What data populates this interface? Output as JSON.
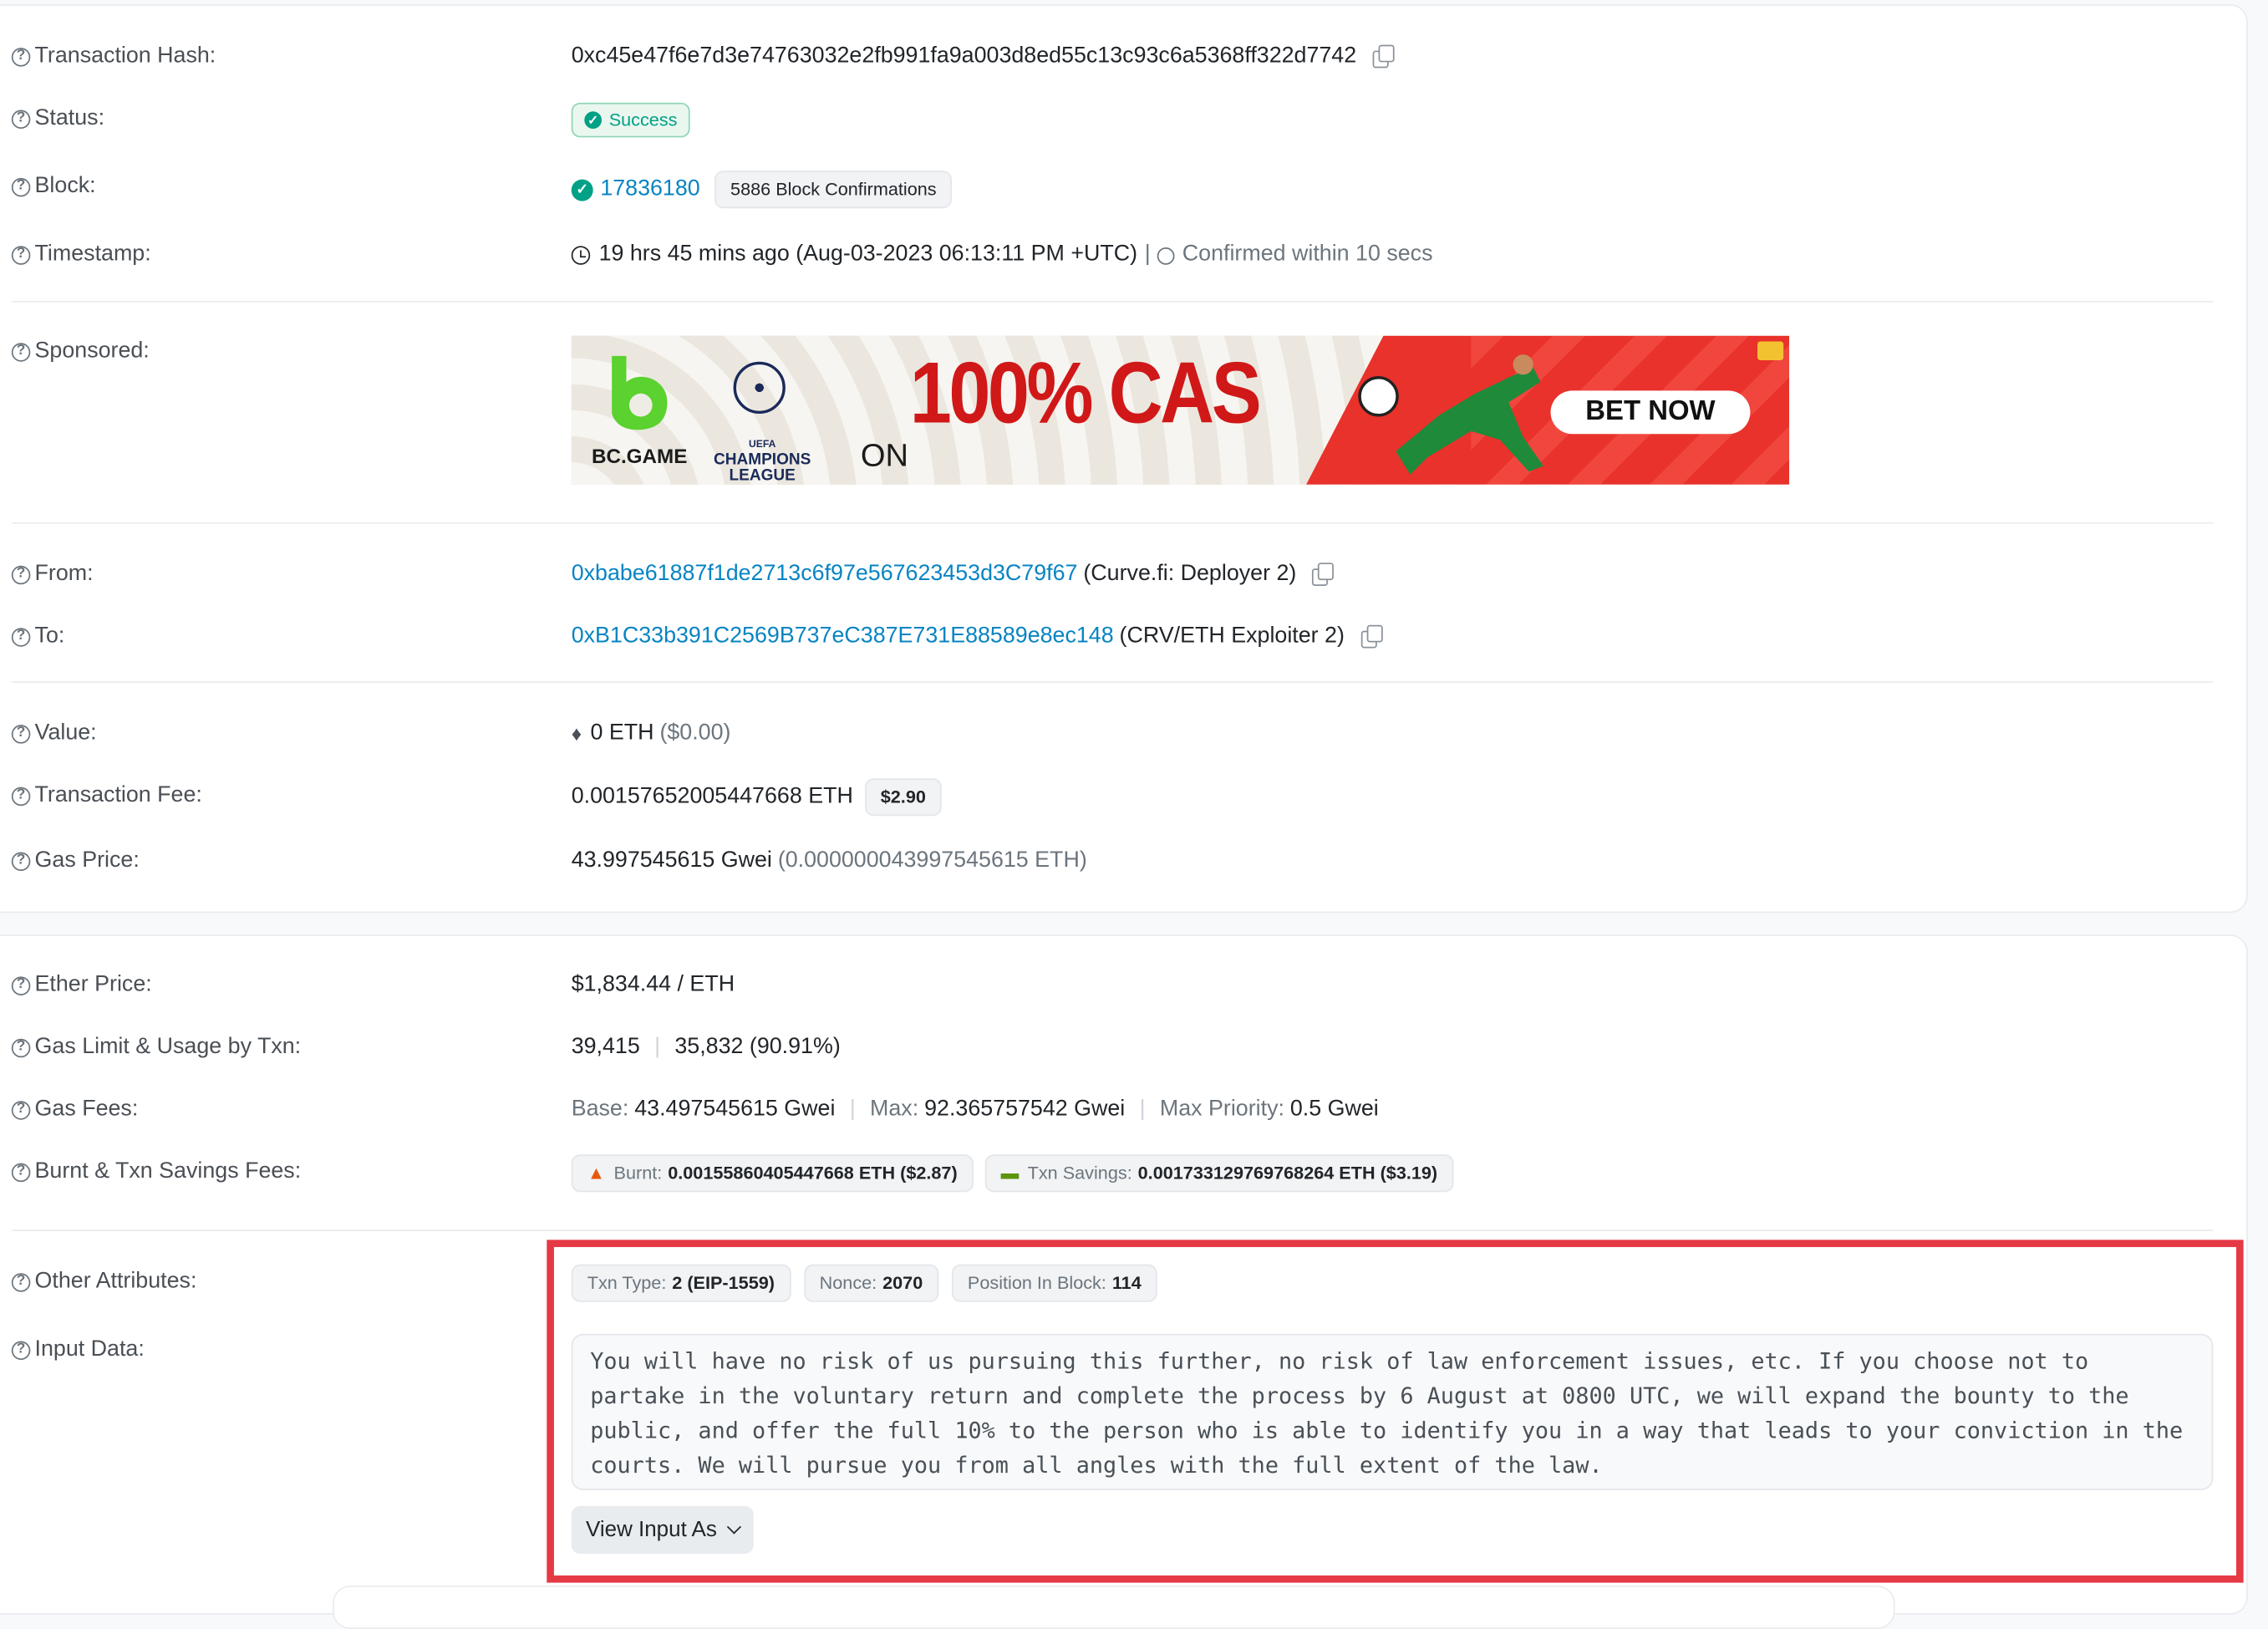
{
  "overview": {
    "tx_hash_label": "Transaction Hash:",
    "tx_hash": "0xc45e47f6e7d3e74763032e2fb991fa9a003d8ed55c13c93c6a5368ff322d7742",
    "status_label": "Status:",
    "status": "Success",
    "block_label": "Block:",
    "block": "17836180",
    "block_confirmations": "5886 Block Confirmations",
    "timestamp_label": "Timestamp:",
    "timestamp": "19 hrs 45 mins ago (Aug-03-2023 06:13:11 PM +UTC)",
    "timestamp_sep": "|",
    "confirmed_within": "Confirmed within 10 secs",
    "sponsored_label": "Sponsored:",
    "ad": {
      "brand": "BC.GAME",
      "uefa_top": "UEFA",
      "uefa_line1": "CHAMPIONS",
      "uefa_line2": "LEAGUE",
      "headline": "100% CAS",
      "on": "ON",
      "cta": "BET NOW"
    },
    "from_label": "From:",
    "from_address": "0xbabe61887f1de2713c6f97e567623453d3C79f67",
    "from_name": "(Curve.fi: Deployer 2)",
    "to_label": "To:",
    "to_address": "0xB1C33b391C2569B737eC387E731E88589e8ec148",
    "to_name": "(CRV/ETH Exploiter 2)",
    "value_label": "Value:",
    "value": "0 ETH",
    "value_usd": "($0.00)",
    "fee_label": "Transaction Fee:",
    "fee": "0.00157652005447668 ETH",
    "fee_usd": "$2.90",
    "gas_price_label": "Gas Price:",
    "gas_price": "43.997545615 Gwei",
    "gas_price_eth": "(0.000000043997545615 ETH)"
  },
  "more": {
    "ether_price_label": "Ether Price:",
    "ether_price": "$1,834.44 / ETH",
    "gas_limit_label": "Gas Limit & Usage by Txn:",
    "gas_limit": "39,415",
    "gas_usage": "35,832 (90.91%)",
    "gas_fees_label": "Gas Fees:",
    "base_label": "Base:",
    "base_value": "43.497545615 Gwei",
    "max_label": "Max:",
    "max_value": "92.365757542 Gwei",
    "max_priority_label": "Max Priority:",
    "max_priority_value": "0.5 Gwei",
    "burnt_label": "Burnt & Txn Savings Fees:",
    "burnt_key": "Burnt:",
    "burnt_value": "0.00155860405447668 ETH ($2.87)",
    "savings_key": "Txn Savings:",
    "savings_value": "0.001733129769768264 ETH ($3.19)",
    "sep": "|",
    "other_attr_label": "Other Attributes:",
    "txn_type_key": "Txn Type:",
    "txn_type_value": "2 (EIP-1559)",
    "nonce_key": "Nonce:",
    "nonce_value": "2070",
    "position_key": "Position In Block:",
    "position_value": "114",
    "input_data_label": "Input Data:",
    "input_data": "You will have no risk of us pursuing this further, no risk of law enforcement issues, etc. If you choose not to partake in the voluntary return and complete the process by 6 August at 0800 UTC, we will expand the bounty to the public, and offer the full 10% to the person who is able to identify you in a way that leads to your conviction in the courts. We will pursue you from all angles with the full extent of the law.",
    "view_input_button": "View Input As"
  },
  "colors": {
    "link": "#0784c3",
    "success": "#00a186",
    "highlight_border": "#e63946",
    "ad_red": "#e8322b"
  },
  "icons": [
    "question-icon",
    "copy-icon",
    "check-circle-icon",
    "clock-icon",
    "timer-icon",
    "ethereum-icon",
    "fire-icon",
    "money-icon",
    "chevron-down-icon"
  ]
}
